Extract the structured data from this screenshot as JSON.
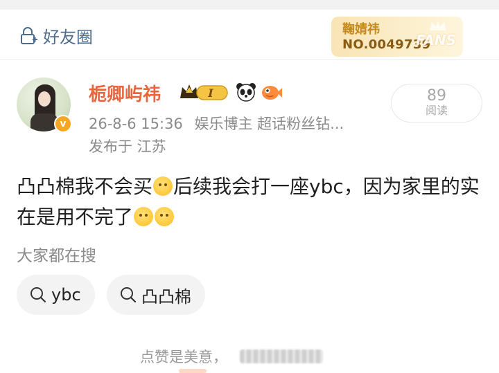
{
  "header": {
    "visibility_label": "好友圈",
    "fans_badge": {
      "name": "鞠婧祎",
      "number": "NO.0049739",
      "word": "FANS"
    }
  },
  "post": {
    "author": "栀卿屿祎",
    "level_badge": "I",
    "timestamp": "26-8-6 15:36",
    "author_tags": "娱乐博主 超话粉丝钻...",
    "location": "发布于 江苏",
    "read_count": "89",
    "read_label": "阅读",
    "text_part1": "凸凸棉我不会买",
    "text_part2": "后续我会打一座ybc，因为家里的实在是用不完了"
  },
  "search": {
    "label": "大家都在搜",
    "chips": [
      {
        "label": "ybc"
      },
      {
        "label": "凸凸棉"
      }
    ]
  },
  "footer": {
    "like_hint": "点赞是美意，"
  },
  "colors": {
    "username": "#e8663c",
    "visibility": "#4d6b8c",
    "badge_gold": "#c58a1e",
    "muted": "#8a8a8a"
  }
}
